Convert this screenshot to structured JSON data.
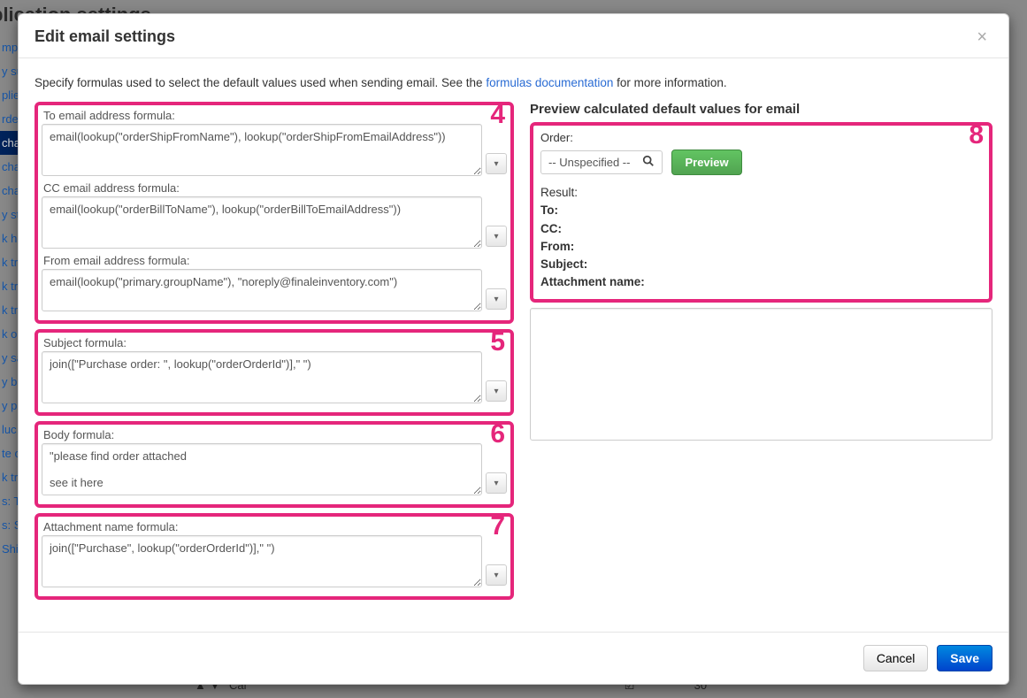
{
  "background": {
    "title": "plication settings",
    "sidebar": [
      "mp",
      "y su",
      "plie",
      "rde",
      "cha",
      "cha",
      "cha",
      "y st",
      "k he",
      "k tr",
      "k tr",
      "k tr",
      "k o",
      "y sa",
      "y bu",
      "y pr",
      "luc",
      "te o",
      "k tr",
      "s: T",
      "s: S",
      "Shipping"
    ],
    "sidebarActiveIndex": 4,
    "bottom": {
      "arrows": "▲  ▼",
      "label": "Cal",
      "check": "☑",
      "value": "30"
    }
  },
  "modal": {
    "title": "Edit email settings",
    "intro_pre": "Specify formulas used to select the default values used when sending email. See the ",
    "intro_link": "formulas documentation",
    "intro_post": " for more information.",
    "groups": [
      {
        "annot": "4",
        "fields": [
          {
            "label": "To email address formula:",
            "value": "email(lookup(\"orderShipFromName\"), lookup(\"orderShipFromEmailAddress\"))",
            "rows": 3
          },
          {
            "label": "CC email address formula:",
            "value": "email(lookup(\"orderBillToName\"), lookup(\"orderBillToEmailAddress\"))",
            "rows": 3
          },
          {
            "label": "From email address formula:",
            "value": "email(lookup(\"primary.groupName\"), \"noreply@finaleinventory.com\")",
            "rows": 2
          }
        ]
      },
      {
        "annot": "5",
        "fields": [
          {
            "label": "Subject formula:",
            "value": "join([\"Purchase order: \", lookup(\"orderOrderId\")],\" \")",
            "rows": 3
          }
        ]
      },
      {
        "annot": "6",
        "fields": [
          {
            "label": "Body formula:",
            "value": "\"please find order attached\n\nsee it here",
            "rows": 3
          }
        ]
      },
      {
        "annot": "7",
        "fields": [
          {
            "label": "Attachment name formula:",
            "value": "join([\"Purchase\", lookup(\"orderOrderId\")],\" \")",
            "rows": 3
          }
        ]
      }
    ],
    "preview": {
      "heading": "Preview calculated default values for email",
      "annot": "8",
      "orderLabel": "Order:",
      "orderValue": "-- Unspecified --",
      "previewBtn": "Preview",
      "resultLabel": "Result:",
      "rows": [
        "To:",
        "CC:",
        "From:",
        "Subject:",
        "Attachment name:"
      ]
    },
    "footer": {
      "cancel": "Cancel",
      "save": "Save"
    }
  }
}
